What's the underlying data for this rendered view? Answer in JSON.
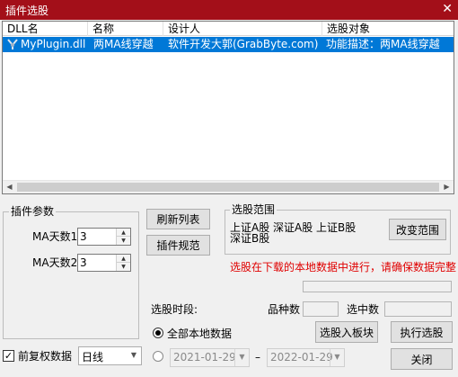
{
  "window": {
    "title": "插件选股",
    "close_glyph": "✕"
  },
  "list": {
    "columns": [
      "DLL名",
      "名称",
      "设计人",
      "选股对象"
    ],
    "rows": [
      {
        "dll": "MyPlugin.dll",
        "name": "两MA线穿越",
        "designer": "软件开发大郭(GrabByte.com)",
        "target": "功能描述：两MA线穿越"
      }
    ]
  },
  "params": {
    "group_label": "插件参数",
    "ma1_label": "MA天数1",
    "ma1_value": "3",
    "ma2_label": "MA天数2",
    "ma2_value": "3"
  },
  "buttons": {
    "refresh": "刷新列表",
    "spec": "插件规范",
    "change_range": "改变范围",
    "to_block": "选股入板块",
    "execute": "执行选股",
    "close": "关闭"
  },
  "range": {
    "group_label": "选股范围",
    "line1": "上证A股  深证A股  上证B股",
    "line2": "深证B股"
  },
  "warning": "选股在下载的本地数据中进行，请确保数据完整",
  "period": {
    "label": "选股时段:",
    "count_label": "品种数",
    "selected_label": "选中数",
    "all_local": "全部本地数据",
    "date_from": "2021-01-29",
    "date_sep": "–",
    "date_to": "2022-01-29"
  },
  "adjust": {
    "label": "前复权数据",
    "checked": true
  },
  "timeframe": {
    "value": "日线"
  },
  "colors": {
    "titlebar": "#a30f19",
    "selection": "#0078d7",
    "warning": "#e00000"
  },
  "icons": {
    "plugin": "plugin-icon"
  }
}
